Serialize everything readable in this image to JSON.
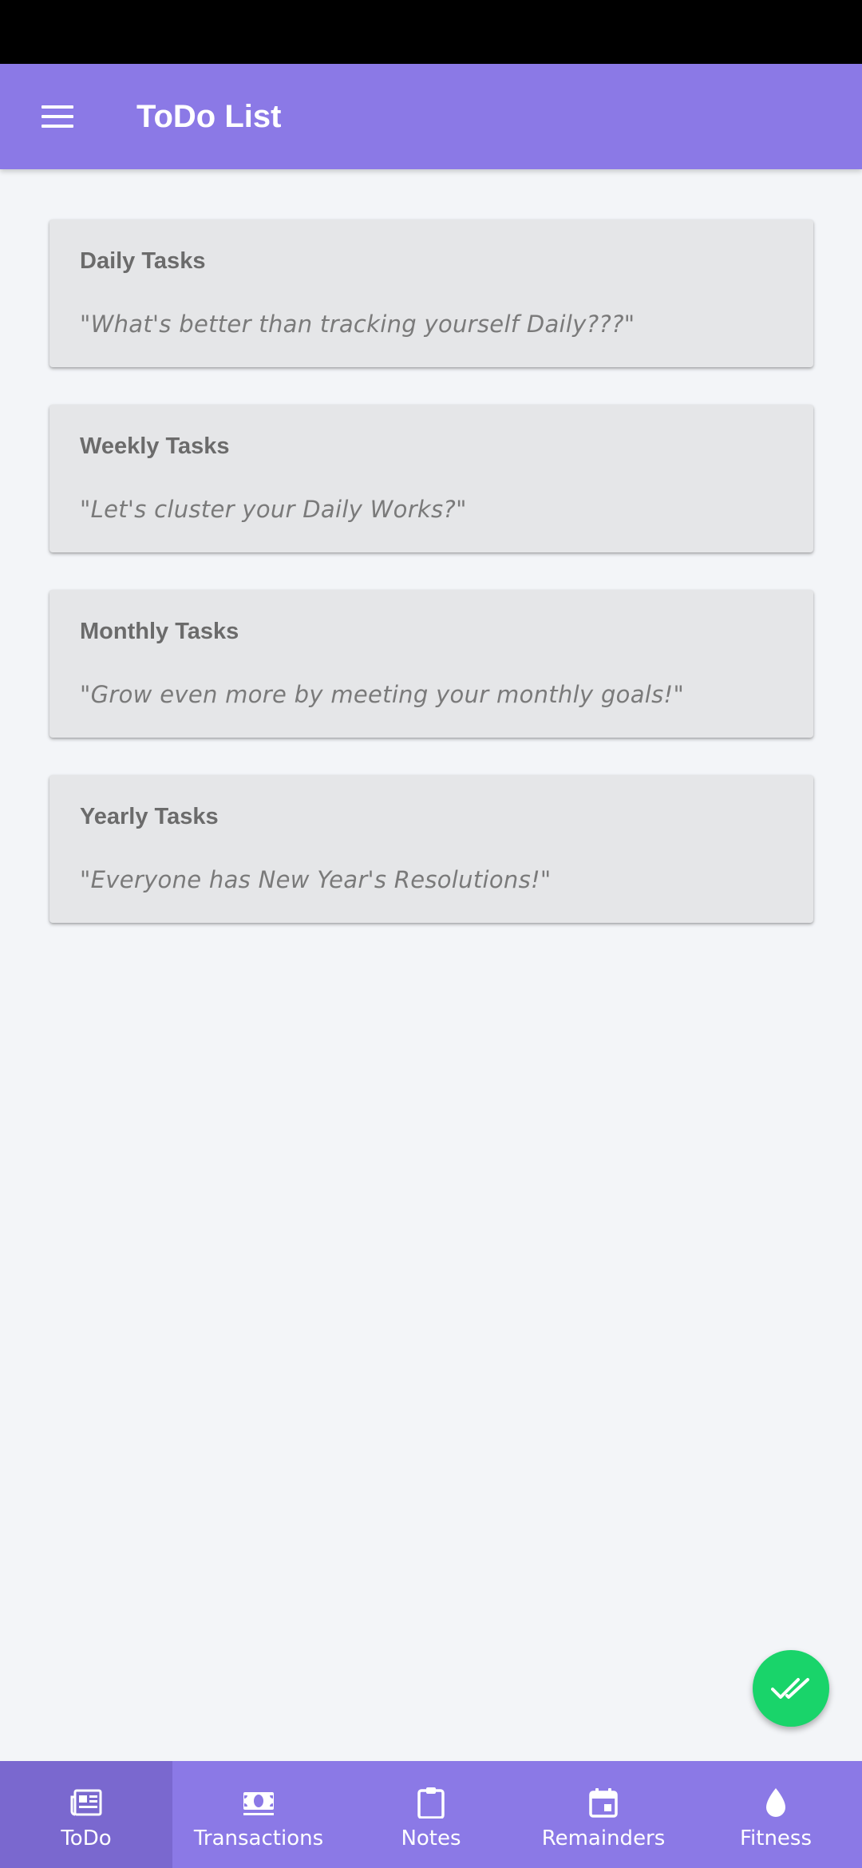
{
  "app_bar": {
    "title": "ToDo List",
    "menu_icon": "hamburger-menu-icon",
    "color": "#8b79e6"
  },
  "cards": [
    {
      "title": "Daily Tasks",
      "quote": "\"What's better than tracking yourself Daily???\""
    },
    {
      "title": "Weekly Tasks",
      "quote": "\"Let's cluster your Daily Works?\""
    },
    {
      "title": "Monthly Tasks",
      "quote": "\"Grow even more by meeting your monthly goals!\""
    },
    {
      "title": "Yearly Tasks",
      "quote": "\"Everyone has New Year's Resolutions!\""
    }
  ],
  "fab": {
    "icon": "double-check-icon",
    "color": "#19d46a"
  },
  "bottom_nav": {
    "active_index": 0,
    "items": [
      {
        "label": "ToDo",
        "icon": "newspaper-icon"
      },
      {
        "label": "Transactions",
        "icon": "money-icon"
      },
      {
        "label": "Notes",
        "icon": "clipboard-icon"
      },
      {
        "label": "Remainders",
        "icon": "calendar-icon"
      },
      {
        "label": "Fitness",
        "icon": "drop-icon"
      }
    ]
  }
}
